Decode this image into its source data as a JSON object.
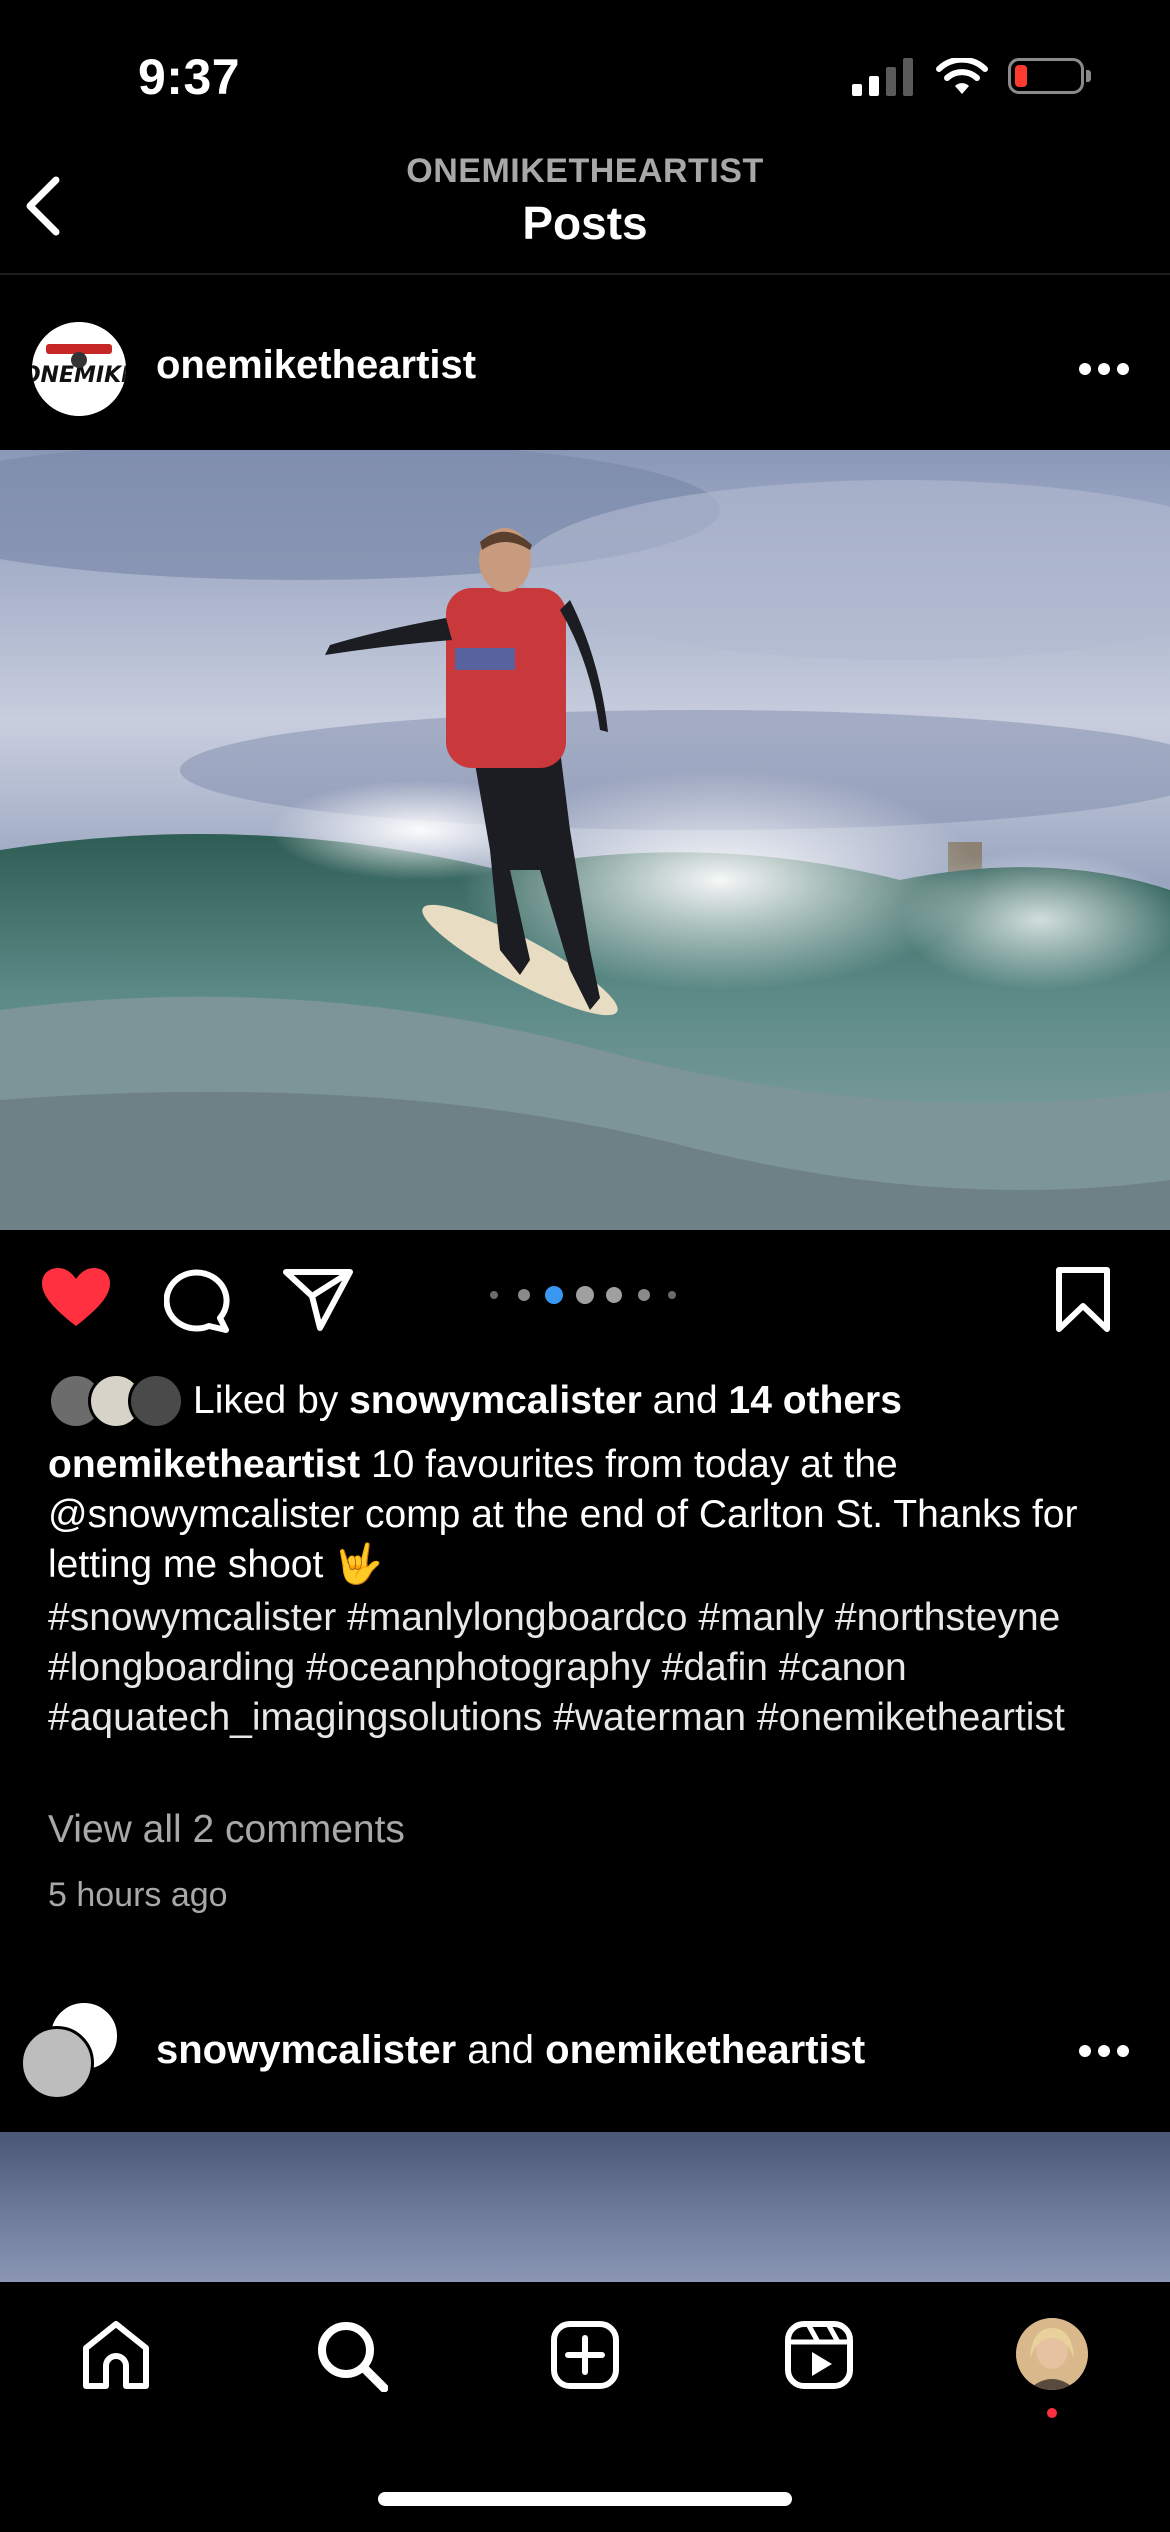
{
  "status_bar": {
    "time": "9:37"
  },
  "header": {
    "username": "ONEMIKETHEARTIST",
    "title": "Posts",
    "back_icon": "chevron-left-icon"
  },
  "post": {
    "username": "onemiketheartist",
    "liked_by_prefix": "Liked by",
    "liked_by_user": "snowymcalister",
    "liked_by_and": "and",
    "liked_by_others": "14 others",
    "caption_user": "onemiketheartist",
    "caption_text": "10 favourites from today at the @snowymcalister comp at the end of Carlton St. Thanks for letting me shoot",
    "caption_emoji": "🤟",
    "hashtags": "#snowymcalister #manlylongboardco #manly #northsteyne #longboarding #oceanphotography #dafin #canon #aquatech_imagingsolutions #waterman #onemiketheartist",
    "view_comments": "View all 2 comments",
    "time_ago": "5 hours ago",
    "carousel": {
      "count": 6,
      "active": 2
    },
    "liked": true,
    "colors": {
      "heart": "#ff3040",
      "active_dot": "#3897f0"
    }
  },
  "post2": {
    "user1": "snowymcalister",
    "and": "and",
    "user2": "onemiketheartist"
  },
  "tabbar": {
    "items": [
      "home-icon",
      "search-icon",
      "create-icon",
      "reels-icon",
      "profile-avatar"
    ]
  }
}
